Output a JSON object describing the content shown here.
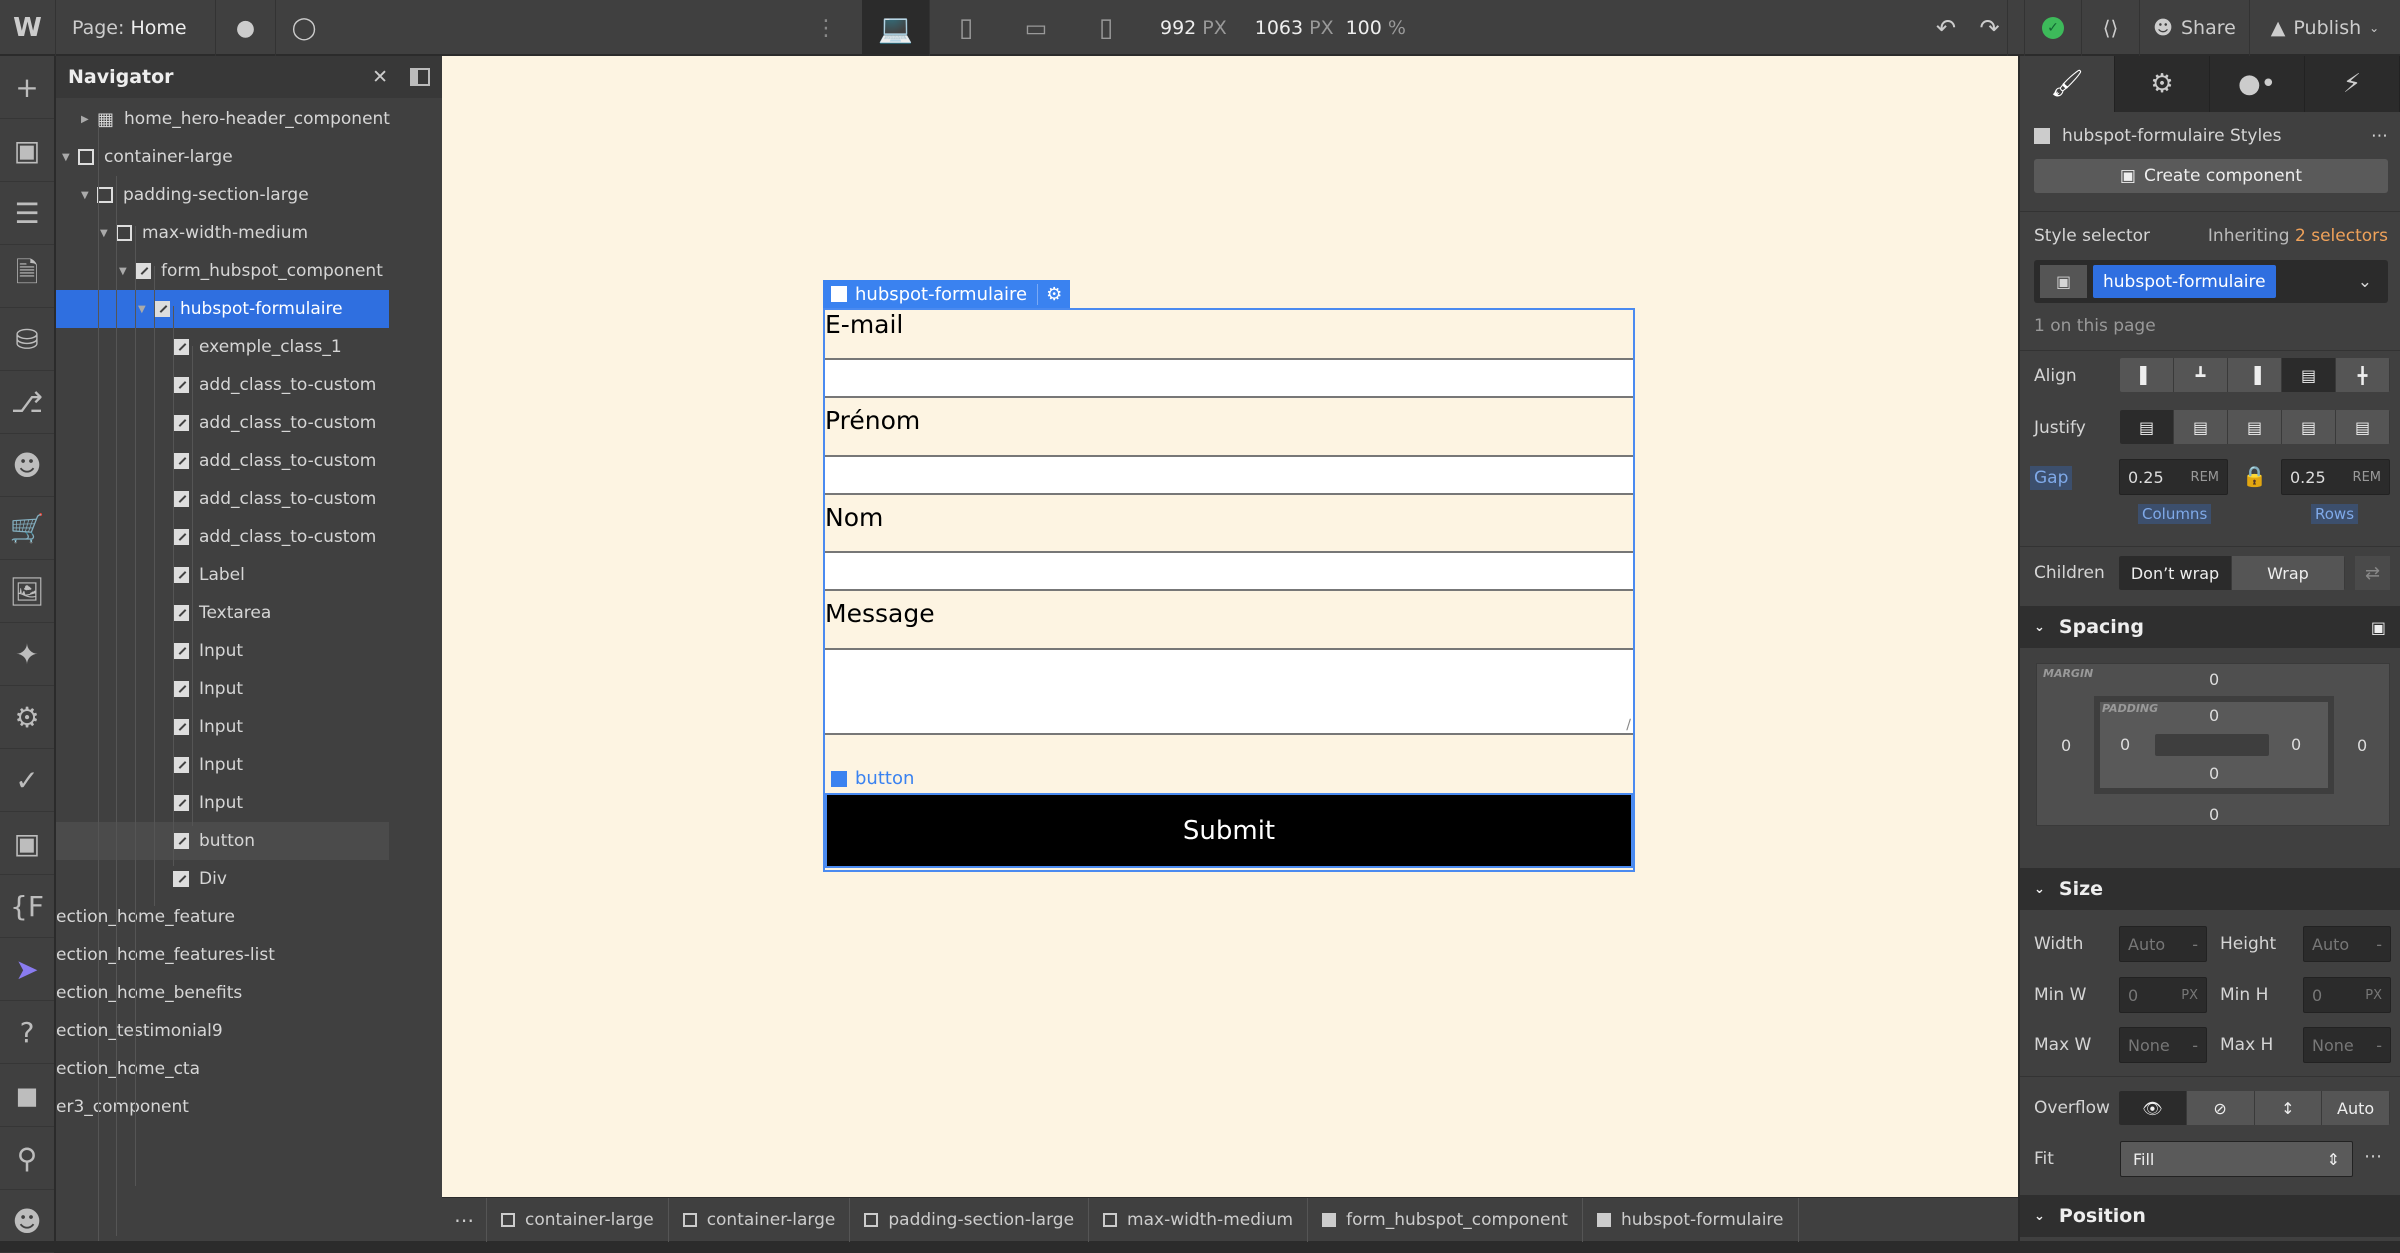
{
  "topbar": {
    "page_label": "Page:",
    "page_name": "Home",
    "width_value": "992",
    "width_unit": "PX",
    "height_value": "1063",
    "height_unit": "PX",
    "zoom_value": "100",
    "zoom_unit": "%",
    "share": "Share",
    "publish": "Publish"
  },
  "leftbar": {
    "icons": [
      "add-icon",
      "components-icon",
      "layers-icon",
      "pages-icon",
      "cms-icon",
      "logic-icon",
      "users-icon",
      "ecommerce-icon",
      "assets-icon",
      "apps-icon",
      "settings-icon",
      "audit-icon",
      "component-box-icon",
      "variables-icon",
      "flow-icon",
      "help-icon",
      "record-icon",
      "search-icon",
      "team-icon"
    ]
  },
  "navigator": {
    "title": "Navigator",
    "items": [
      {
        "label": "home_hero-header_component",
        "level": 1,
        "arrow": "right",
        "kind": "component"
      },
      {
        "label": "container-large",
        "level": 0,
        "arrow": "down",
        "kind": "box"
      },
      {
        "label": "padding-section-large",
        "level": 1,
        "arrow": "down",
        "kind": "box"
      },
      {
        "label": "max-width-medium",
        "level": 2,
        "arrow": "down",
        "kind": "box"
      },
      {
        "label": "form_hubspot_component",
        "level": 3,
        "arrow": "down",
        "kind": "edit"
      },
      {
        "label": "hubspot-formulaire",
        "level": 4,
        "arrow": "down",
        "kind": "edit",
        "selected": true
      },
      {
        "label": "exemple_class_1",
        "level": 5,
        "kind": "edit"
      },
      {
        "label": "add_class_to-custom",
        "level": 5,
        "kind": "edit"
      },
      {
        "label": "add_class_to-custom",
        "level": 5,
        "kind": "edit"
      },
      {
        "label": "add_class_to-custom",
        "level": 5,
        "kind": "edit"
      },
      {
        "label": "add_class_to-custom",
        "level": 5,
        "kind": "edit"
      },
      {
        "label": "add_class_to-custom",
        "level": 5,
        "kind": "edit"
      },
      {
        "label": "Label",
        "level": 5,
        "kind": "edit"
      },
      {
        "label": "Textarea",
        "level": 5,
        "kind": "edit"
      },
      {
        "label": "Input",
        "level": 5,
        "kind": "edit"
      },
      {
        "label": "Input",
        "level": 5,
        "kind": "edit"
      },
      {
        "label": "Input",
        "level": 5,
        "kind": "edit"
      },
      {
        "label": "Input",
        "level": 5,
        "kind": "edit"
      },
      {
        "label": "Input",
        "level": 5,
        "kind": "edit"
      },
      {
        "label": "button",
        "level": 5,
        "kind": "edit",
        "hover": true
      },
      {
        "label": "Div",
        "level": 5,
        "kind": "edit"
      },
      {
        "label": "ection_home_feature",
        "level": -1
      },
      {
        "label": "ection_home_features-list",
        "level": -1
      },
      {
        "label": "ection_home_benefits",
        "level": -1
      },
      {
        "label": "ection_testimonial9",
        "level": -1
      },
      {
        "label": "ection_home_cta",
        "level": -1
      },
      {
        "label": "er3_component",
        "level": -1
      }
    ]
  },
  "canvas": {
    "element_tag": "hubspot-formulaire",
    "button_tag": "button",
    "fields": [
      {
        "label": "E-mail"
      },
      {
        "label": "Prénom"
      },
      {
        "label": "Nom"
      },
      {
        "label": "Message"
      }
    ],
    "submit": "Submit",
    "background": "#fdf4e2"
  },
  "style_panel": {
    "tabs": [
      "style-brush-icon",
      "settings-gear-icon",
      "interactions-drops-icon",
      "lightning-icon"
    ],
    "styles_title": "hubspot-formulaire Styles",
    "create_component": "Create component",
    "style_selector_label": "Style selector",
    "inheriting": "Inheriting",
    "inheriting_count": "2 selectors",
    "selector_class": "hubspot-formulaire",
    "on_page": "1 on this page",
    "align_label": "Align",
    "align_selected": "stretch",
    "justify_label": "Justify",
    "justify_selected": "start",
    "gap_label": "Gap",
    "gap_columns": "0.25",
    "gap_rows": "0.25",
    "gap_unit": "REM",
    "columns_label": "Columns",
    "rows_label": "Rows",
    "children_label": "Children",
    "dont_wrap": "Don’t wrap",
    "wrap": "Wrap",
    "spacing": {
      "title": "Spacing",
      "margin_label": "MARGIN",
      "padding_label": "PADDING",
      "margin": {
        "top": "0",
        "right": "0",
        "bottom": "0",
        "left": "0"
      },
      "padding": {
        "top": "0",
        "right": "0",
        "bottom": "0",
        "left": "0"
      }
    },
    "size": {
      "title": "Size",
      "width_label": "Width",
      "width": "Auto",
      "height_label": "Height",
      "height": "Auto",
      "minw_label": "Min W",
      "minw": "0",
      "minh_label": "Min H",
      "minh": "0",
      "maxw_label": "Max W",
      "maxw": "None",
      "maxh_label": "Max H",
      "maxh": "None",
      "px": "PX",
      "dash": "-"
    },
    "overflow_label": "Overflow",
    "overflow_auto": "Auto",
    "fit_label": "Fit",
    "fit_value": "Fill",
    "position_title": "Position",
    "accent": "#2f6fe0",
    "highlight": "#f0a25a"
  },
  "breadcrumbs": [
    "container-large",
    "container-large",
    "padding-section-large",
    "max-width-medium",
    "form_hubspot_component",
    "hubspot-formulaire"
  ],
  "breadcrumb_kinds": [
    "box",
    "box",
    "box",
    "box",
    "edit",
    "edit"
  ]
}
